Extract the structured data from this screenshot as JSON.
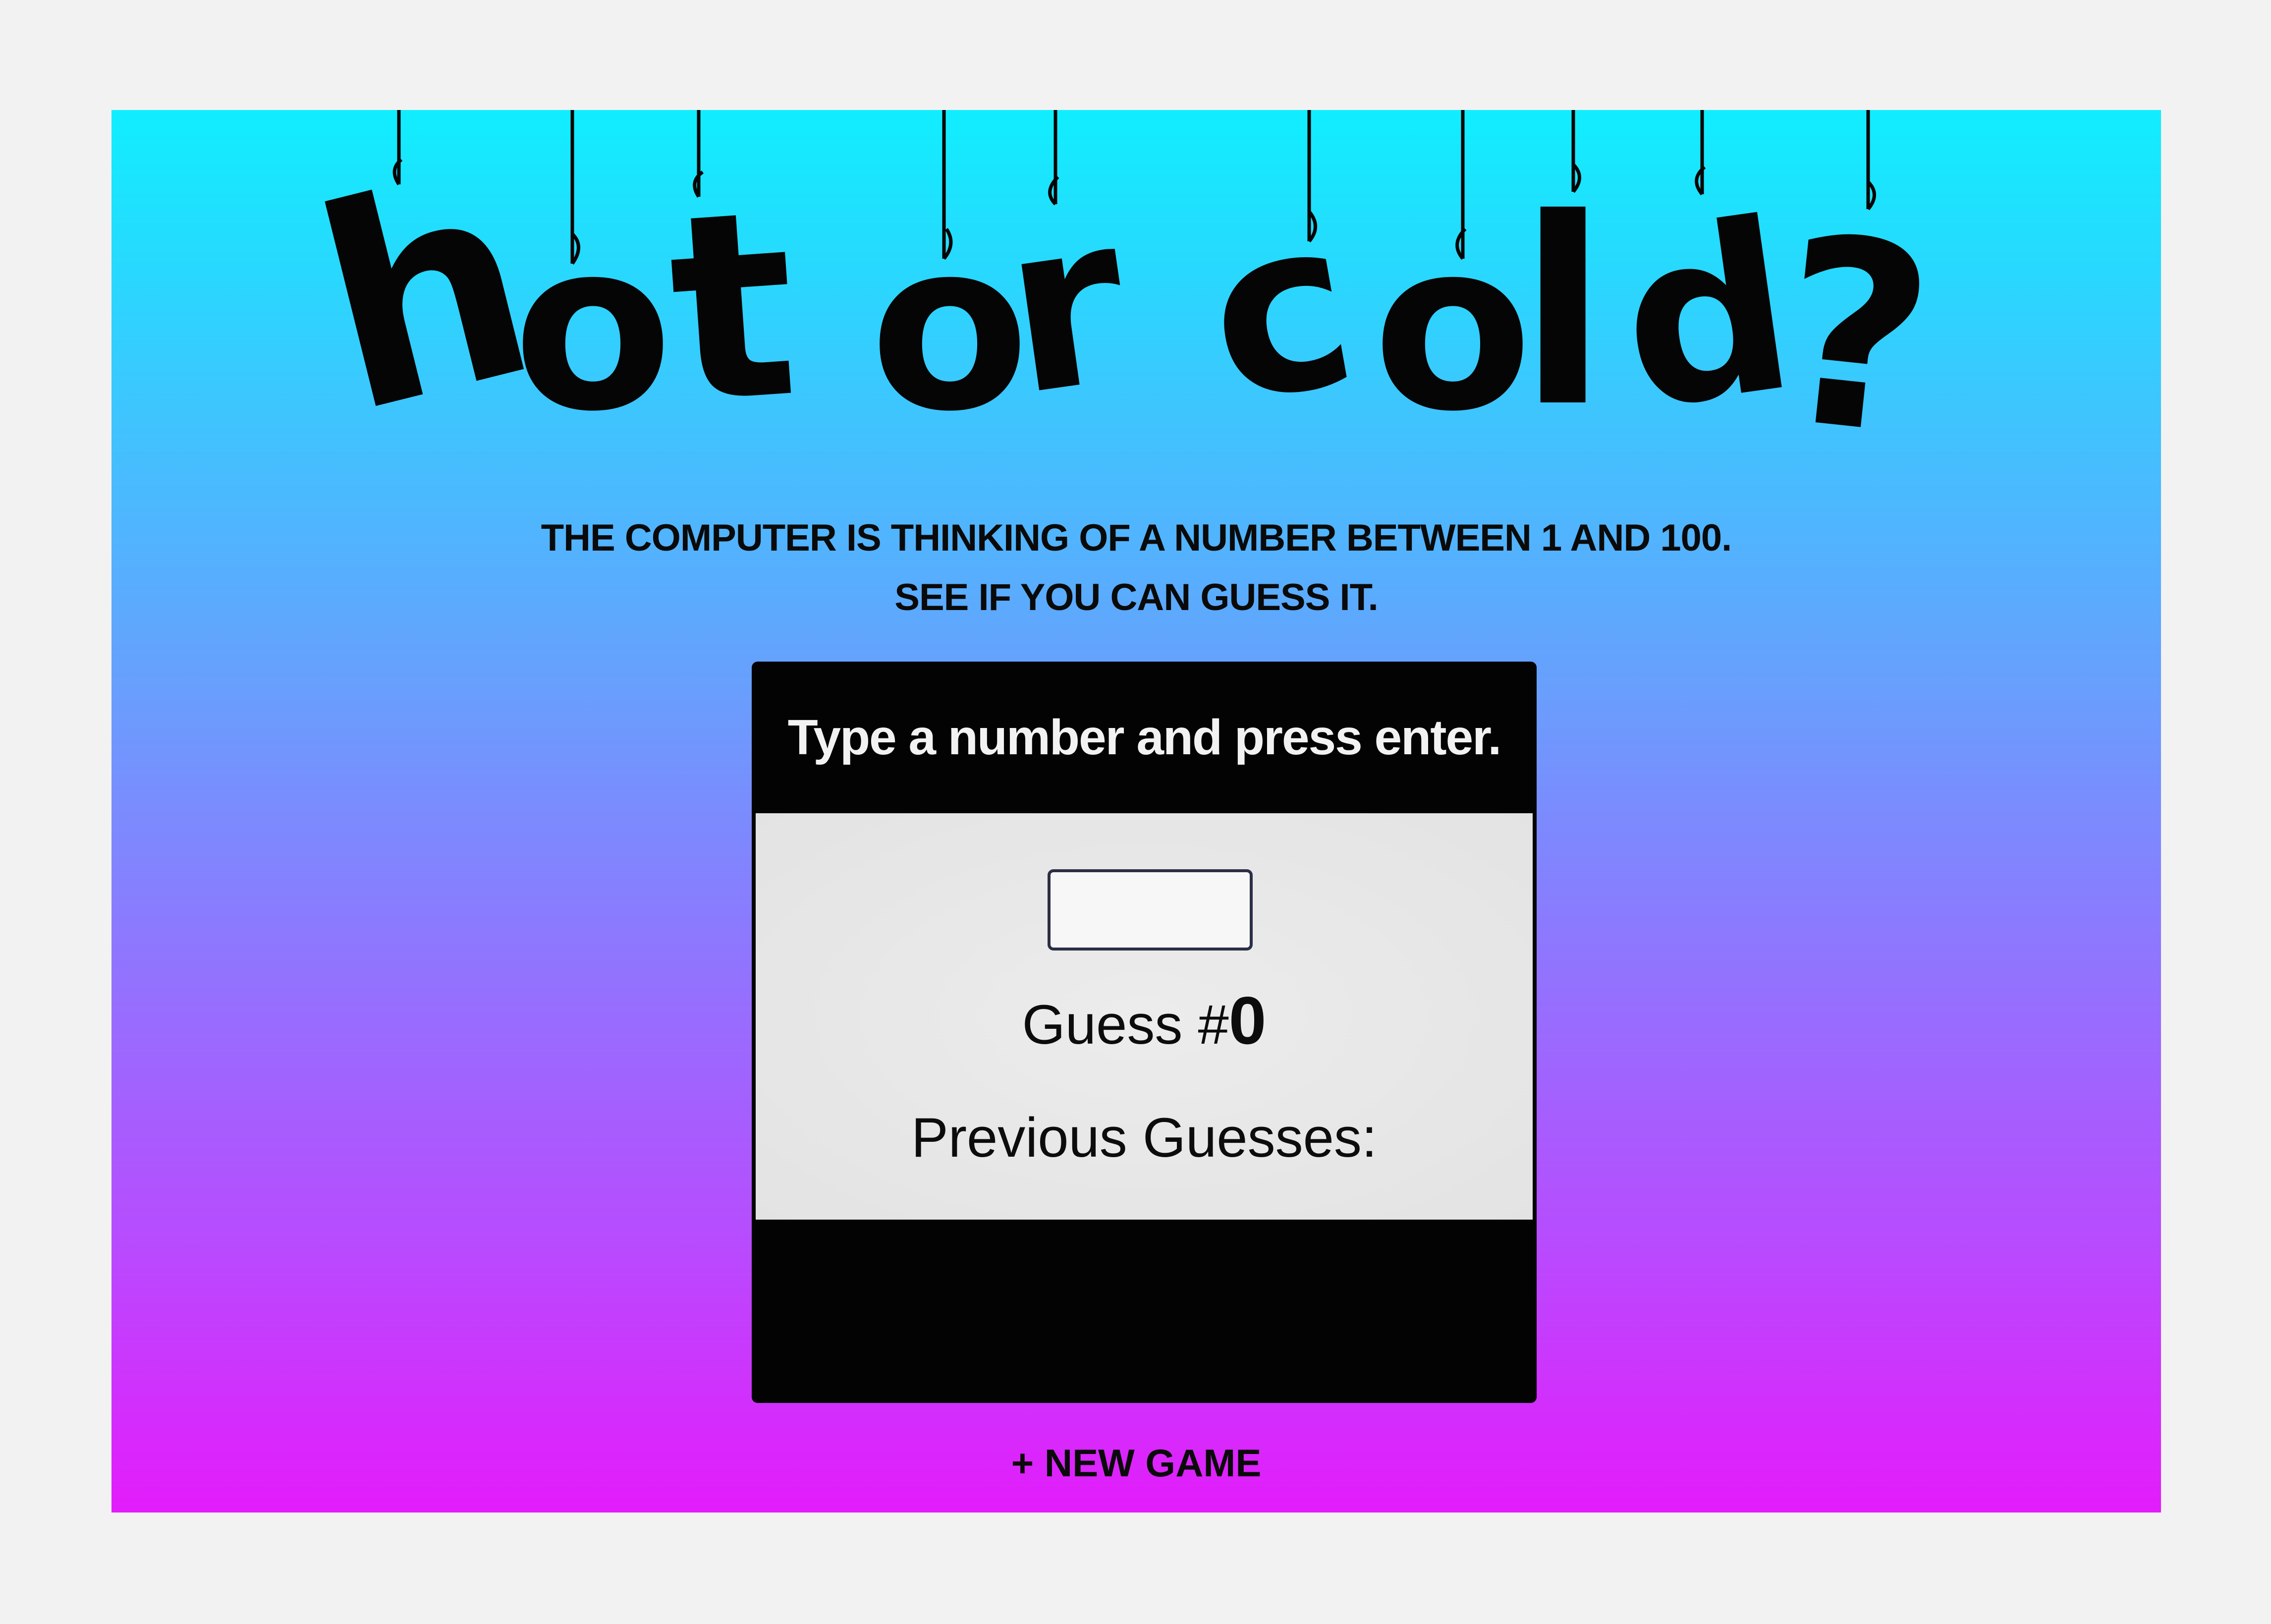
{
  "header": {
    "title_letters": [
      "h",
      "o",
      "t",
      "o",
      "r",
      "c",
      "o",
      "l",
      "d",
      "?"
    ],
    "title_text": "hot or cold?"
  },
  "intro": {
    "line1": "THE COMPUTER IS THINKING OF A NUMBER BETWEEN 1 AND 100.",
    "line2": "SEE IF YOU CAN GUESS IT."
  },
  "game": {
    "feedback": "Type a number and press enter.",
    "input_value": "",
    "counter_label": "Guess #",
    "counter_value": "0",
    "previous_label": "Previous Guesses:",
    "previous_guesses": []
  },
  "nav": {
    "new_game": "+ NEW GAME"
  },
  "colors": {
    "gradient_top": "#10eefe",
    "gradient_bottom": "#e31cfb",
    "panel": "#030303",
    "panel_body": "#e6e6e6"
  }
}
